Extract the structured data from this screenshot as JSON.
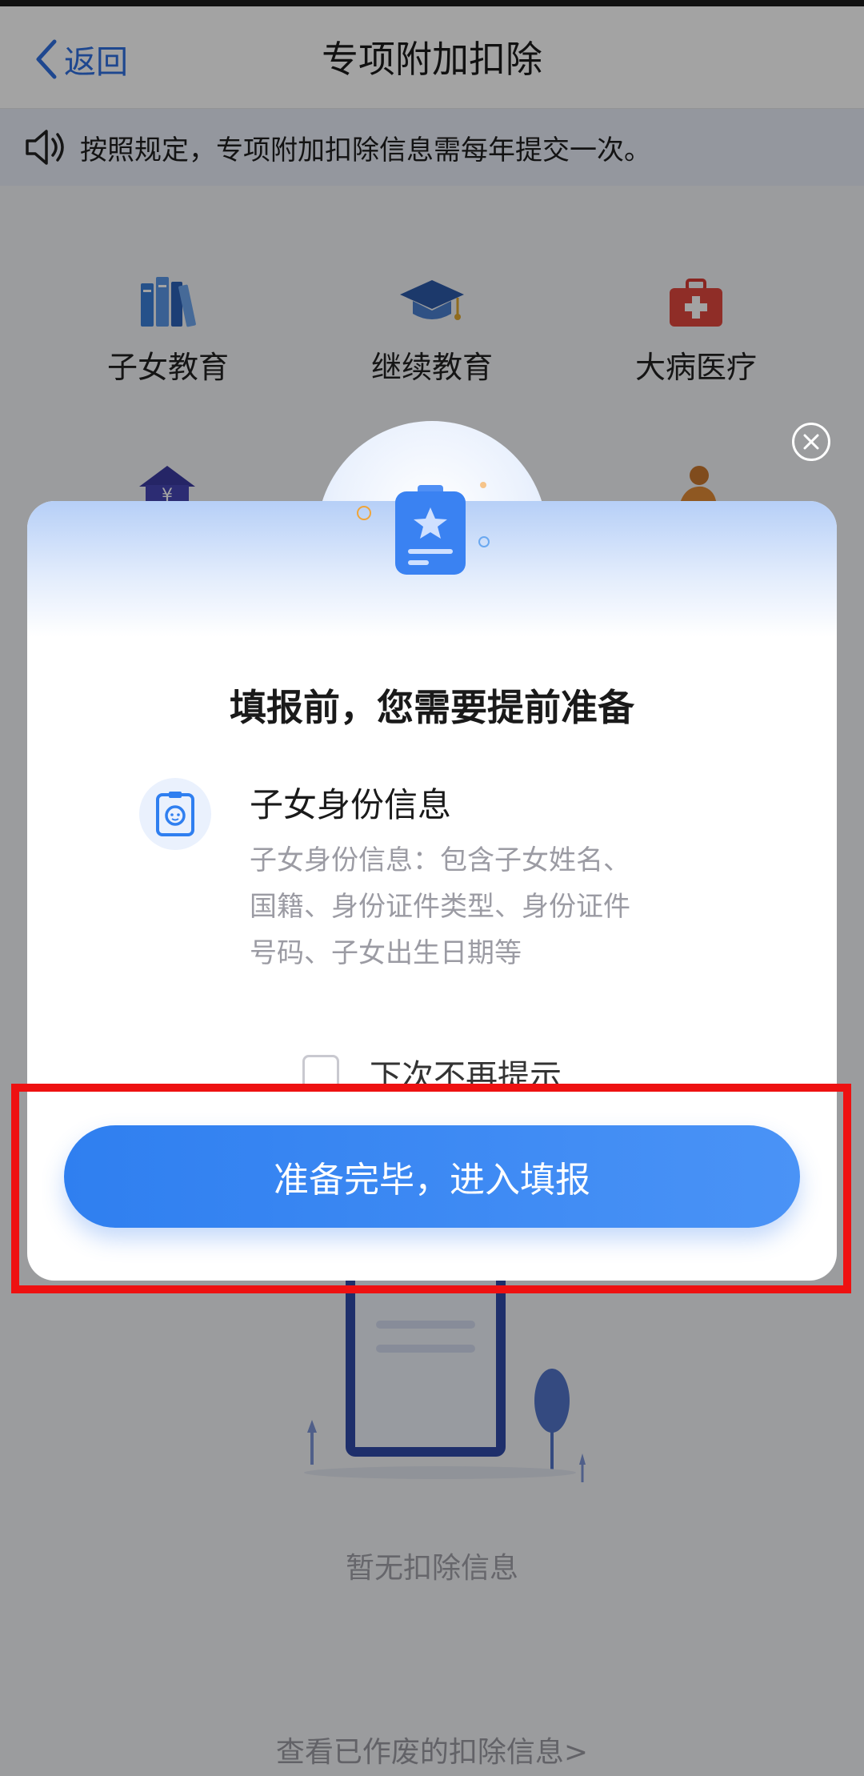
{
  "nav": {
    "back_label": "返回",
    "title": "专项附加扣除"
  },
  "notice": {
    "text": "按照规定，专项附加扣除信息需每年提交一次。"
  },
  "categories": [
    {
      "label": "子女教育",
      "icon": "books-icon"
    },
    {
      "label": "继续教育",
      "icon": "graduation-cap-icon"
    },
    {
      "label": "大病医疗",
      "icon": "medical-kit-icon"
    }
  ],
  "empty": {
    "text": "暂无扣除信息",
    "void_link": "查看已作废的扣除信息>"
  },
  "dialog": {
    "title": "填报前，您需要提前准备",
    "requirement": {
      "title": "子女身份信息",
      "desc_lines": [
        "子女身份信息：包含子女姓名、",
        "国籍、身份证件类型、身份证件",
        "号码、子女出生日期等"
      ]
    },
    "remember_label": "下次不再提示",
    "remember_checked": false,
    "confirm_label": "准备完毕，进入填报"
  },
  "colors": {
    "accent": "#2f7ff0",
    "highlight": "#ee1111"
  }
}
